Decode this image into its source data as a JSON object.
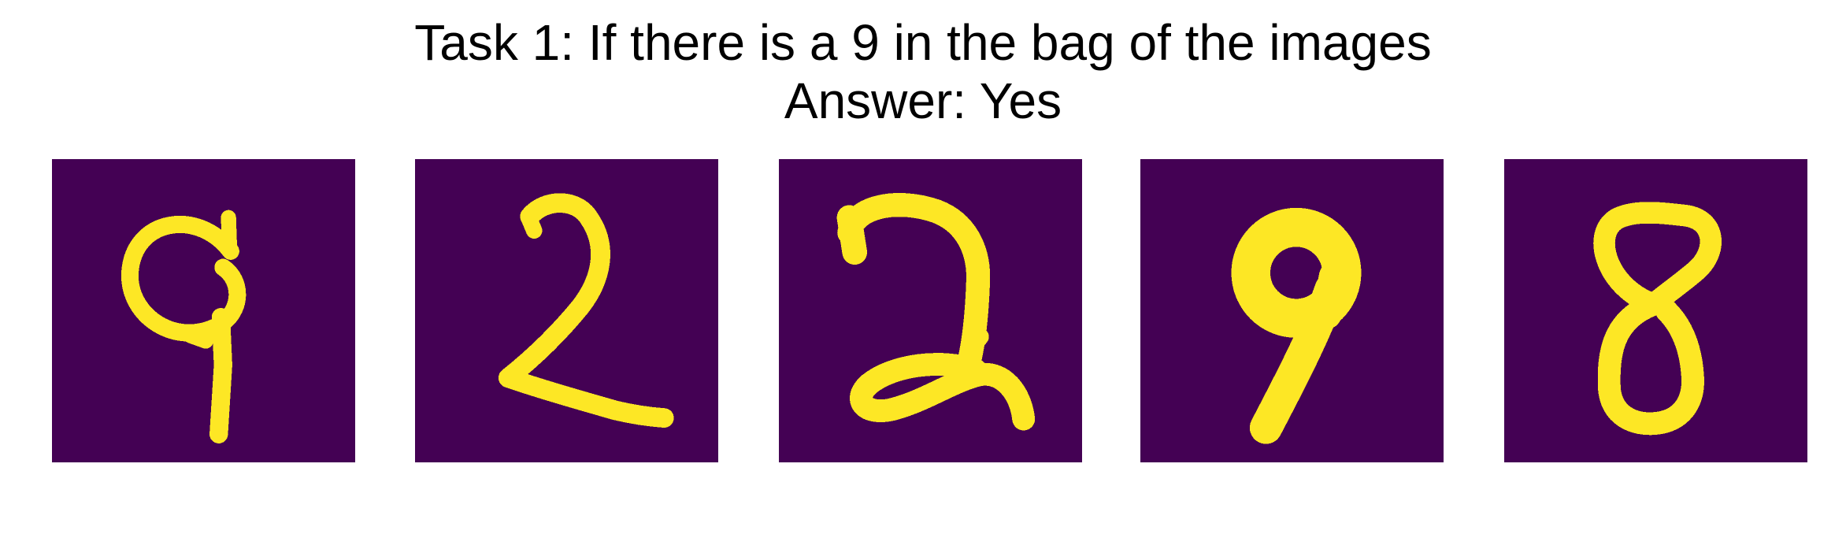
{
  "figure": {
    "title": "Task 1: If there is a 9 in the bag of the images",
    "answer": "Answer: Yes"
  },
  "colors": {
    "background": "#440154",
    "foreground": "#fde725"
  },
  "images": [
    {
      "digit": "9"
    },
    {
      "digit": "2"
    },
    {
      "digit": "2"
    },
    {
      "digit": "9"
    },
    {
      "digit": "8"
    }
  ]
}
